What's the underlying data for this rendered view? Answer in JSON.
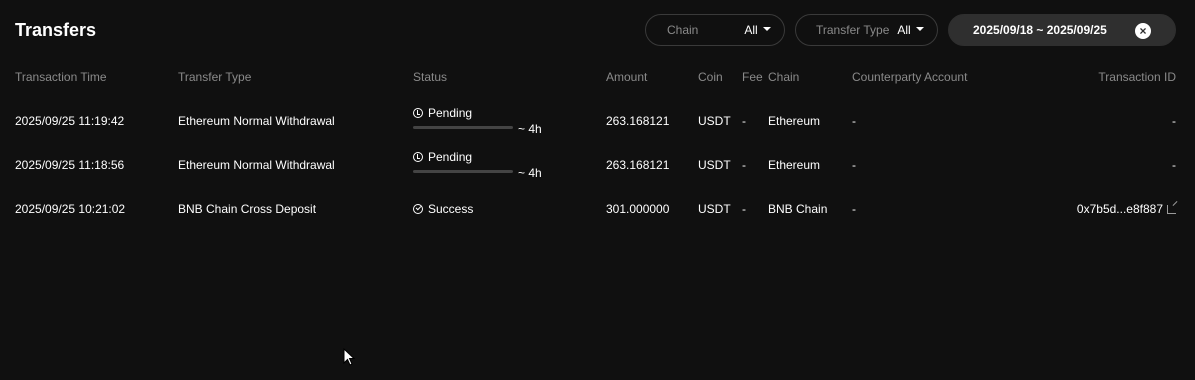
{
  "page": {
    "title": "Transfers"
  },
  "filters": {
    "chain": {
      "label": "Chain",
      "value": "All"
    },
    "transfer_type": {
      "label": "Transfer Type",
      "value": "All"
    },
    "date_range": "2025/09/18 ~ 2025/09/25"
  },
  "table": {
    "headers": {
      "time": "Transaction Time",
      "type": "Transfer Type",
      "status": "Status",
      "amount": "Amount",
      "coin": "Coin",
      "fee": "Fee",
      "chain": "Chain",
      "counterparty": "Counterparty Account",
      "txid": "Transaction ID"
    },
    "rows": [
      {
        "time": "2025/09/25 11:19:42",
        "type": "Ethereum Normal Withdrawal",
        "status": "Pending",
        "eta": "~ 4h",
        "amount": "263.168121",
        "coin": "USDT",
        "fee": "-",
        "chain": "Ethereum",
        "counterparty": "-",
        "txid": "-"
      },
      {
        "time": "2025/09/25 11:18:56",
        "type": "Ethereum Normal Withdrawal",
        "status": "Pending",
        "eta": "~ 4h",
        "amount": "263.168121",
        "coin": "USDT",
        "fee": "-",
        "chain": "Ethereum",
        "counterparty": "-",
        "txid": "-"
      },
      {
        "time": "2025/09/25 10:21:02",
        "type": "BNB Chain Cross Deposit",
        "status": "Success",
        "amount": "301.000000",
        "coin": "USDT",
        "fee": "-",
        "chain": "BNB Chain",
        "counterparty": "-",
        "txid": "0x7b5d...e8f887"
      }
    ]
  },
  "colors": {
    "background": "#101010",
    "text": "#ffffff",
    "muted": "#8a8a8a",
    "chip": "#2f2f2f"
  }
}
